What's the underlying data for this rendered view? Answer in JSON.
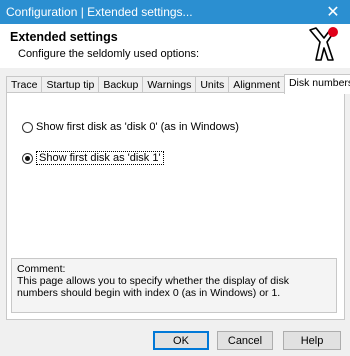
{
  "window": {
    "title": "Configuration | Extended settings...",
    "close_glyph": "✕"
  },
  "header": {
    "title": "Extended settings",
    "subtitle": "Configure the seldomly used options:"
  },
  "tabs": [
    {
      "label": "Trace"
    },
    {
      "label": "Startup tip"
    },
    {
      "label": "Backup"
    },
    {
      "label": "Warnings"
    },
    {
      "label": "Units"
    },
    {
      "label": "Alignment"
    },
    {
      "label": "Disk numbers",
      "active": true
    }
  ],
  "options": {
    "opt1": {
      "label": "Show first disk as 'disk 0' (as in Windows)",
      "checked": false
    },
    "opt2": {
      "label": "Show first disk as 'disk 1'",
      "checked": true
    }
  },
  "comment": {
    "heading": "Comment:",
    "text": "This page allows you to specify whether the display of disk numbers should begin with index 0 (as in Windows) or 1."
  },
  "buttons": {
    "ok": "OK",
    "cancel": "Cancel",
    "help": "Help"
  }
}
